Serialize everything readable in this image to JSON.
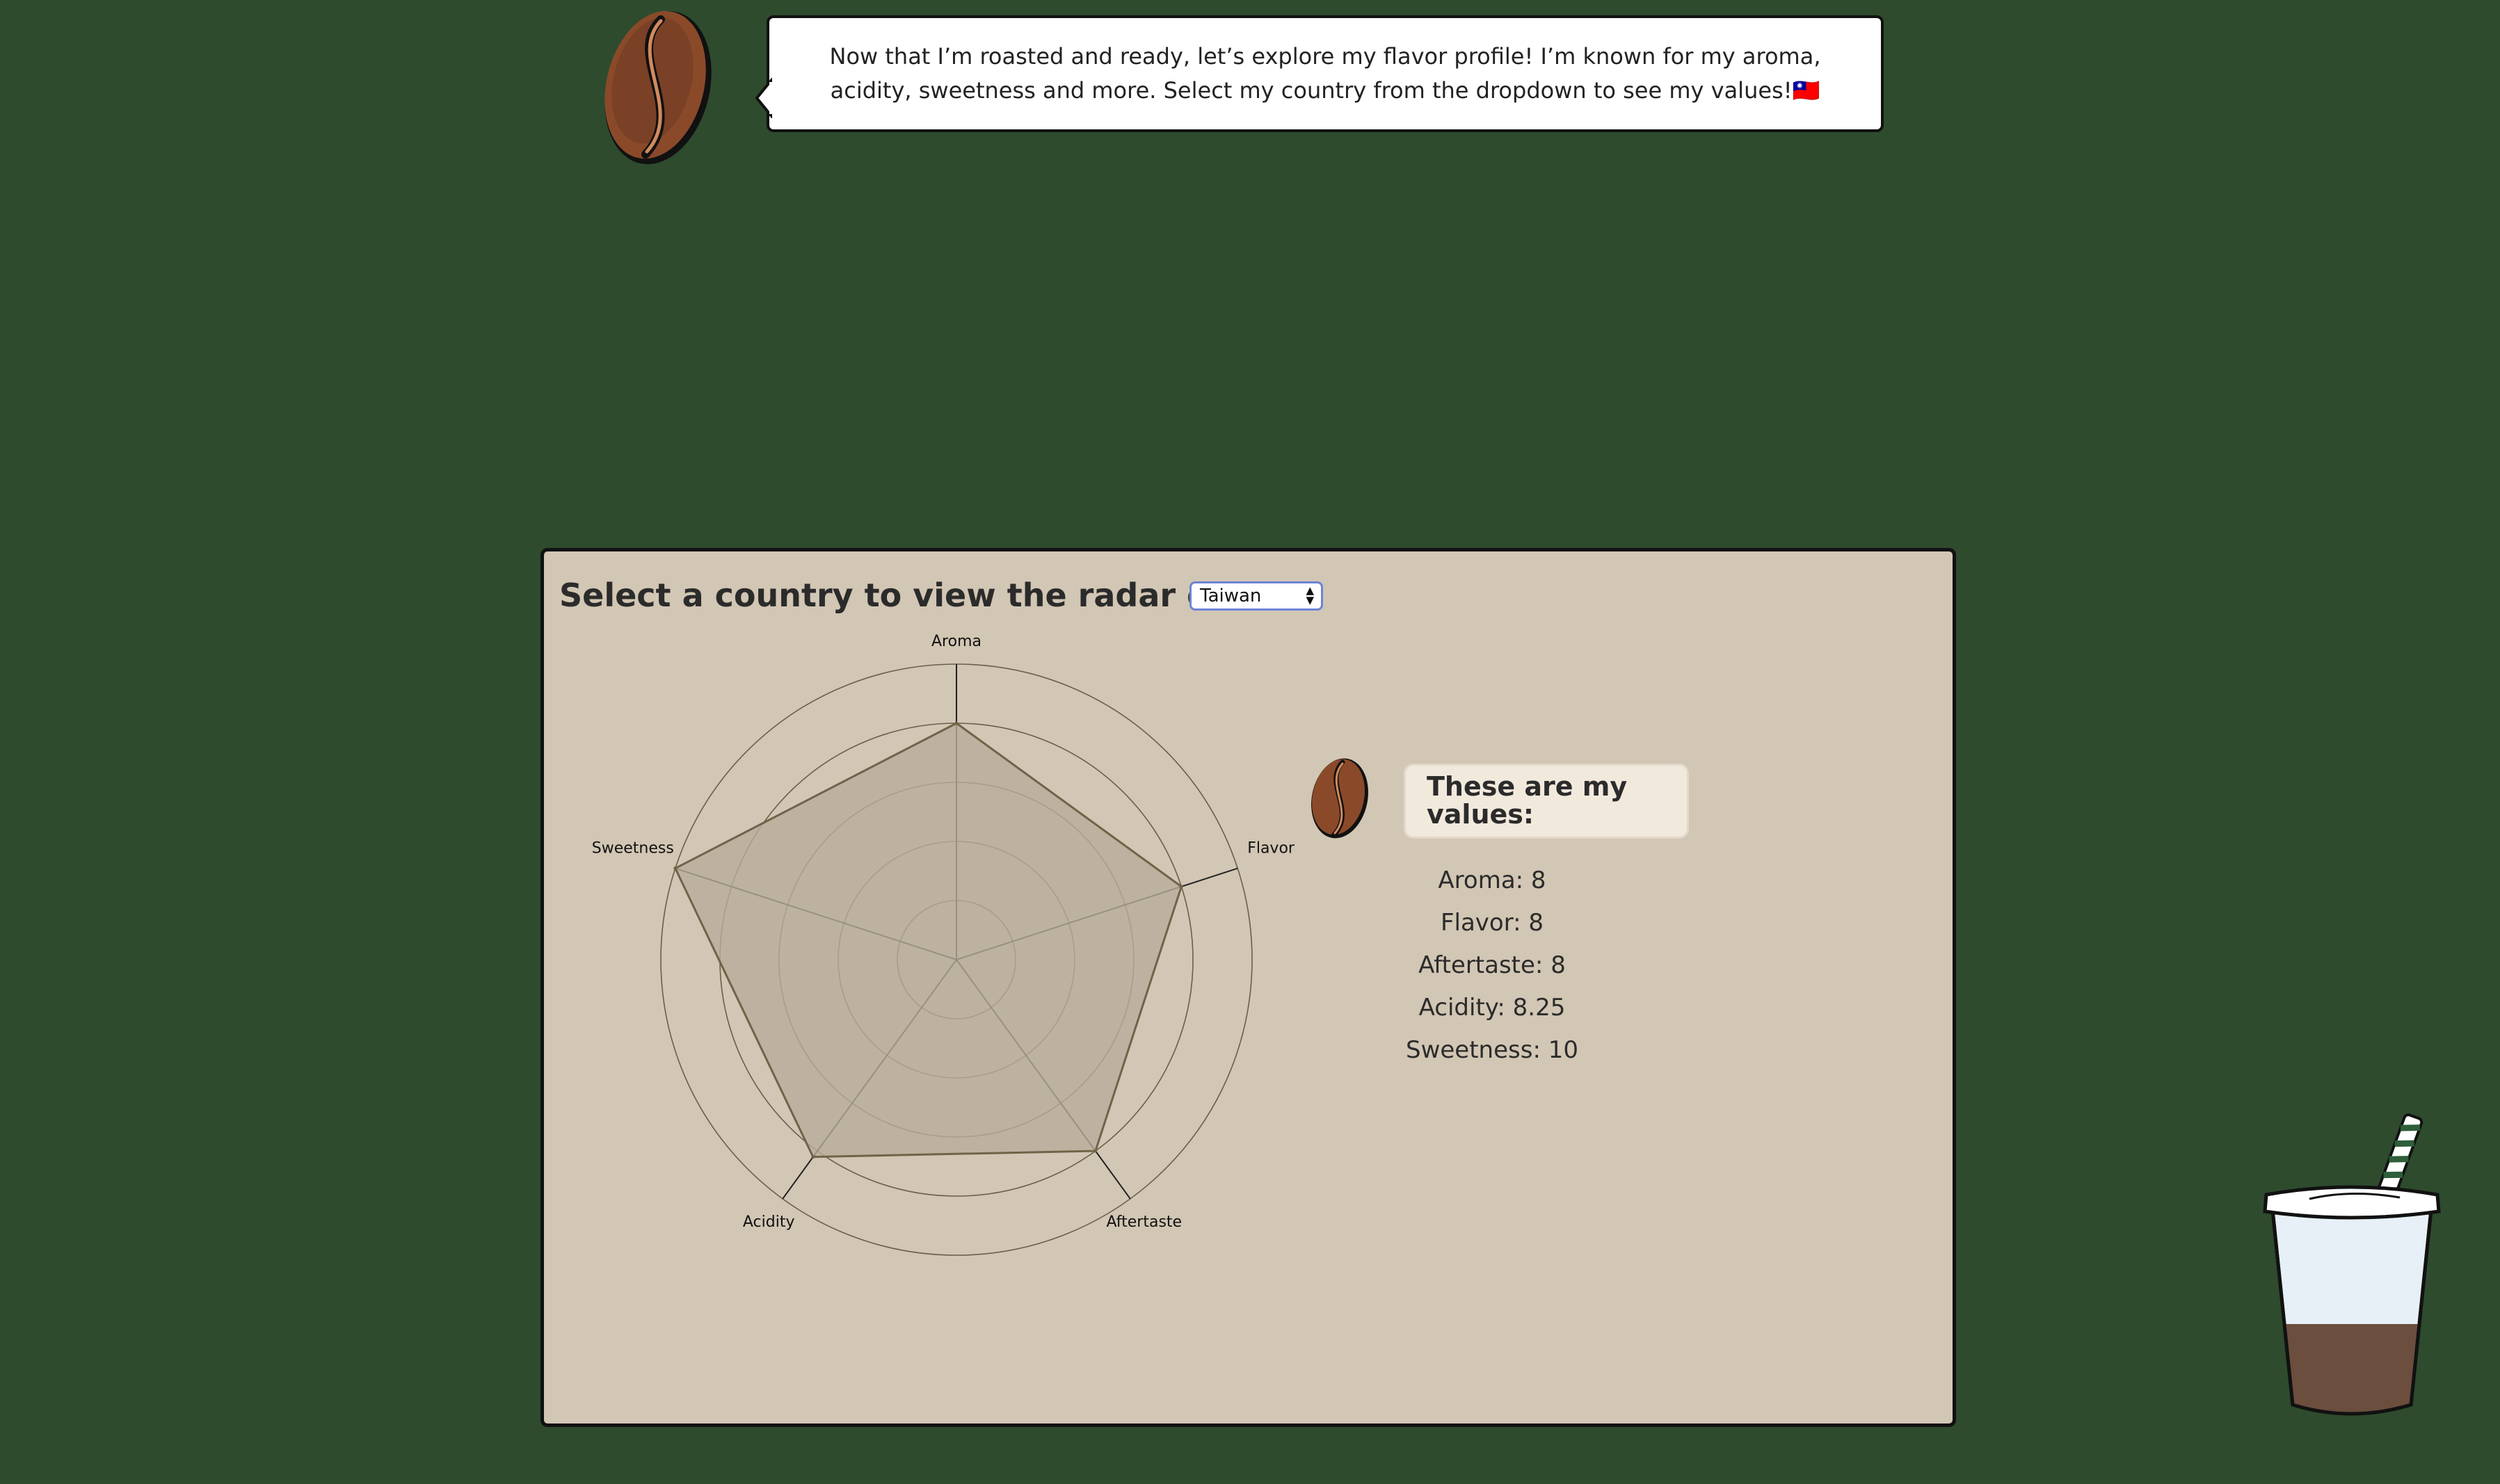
{
  "intro": {
    "message": "Now that I’m roasted and ready, let’s explore my flavor profile! I’m known for my aroma, acidity, sweetness and more. Select my country from the dropdown to see my values!🇹🇼"
  },
  "panel": {
    "heading": "Select a country to view the radar chart:",
    "country_select": {
      "selected": "Taiwan"
    }
  },
  "values": {
    "heading": "These are my values:",
    "lines": [
      "Aroma: 8",
      "Flavor: 8",
      "Aftertaste: 8",
      "Acidity: 8.25",
      "Sweetness: 10"
    ]
  },
  "chart_data": {
    "type": "radar",
    "axes": [
      "Aroma",
      "Flavor",
      "Aftertaste",
      "Acidity",
      "Sweetness"
    ],
    "values": [
      8,
      8,
      8,
      8.25,
      10
    ],
    "rlim": [
      0,
      10
    ],
    "colors": {
      "fill": "#b8ad9a",
      "stroke": "#6f6448",
      "grid": "#6b5f4a"
    }
  }
}
